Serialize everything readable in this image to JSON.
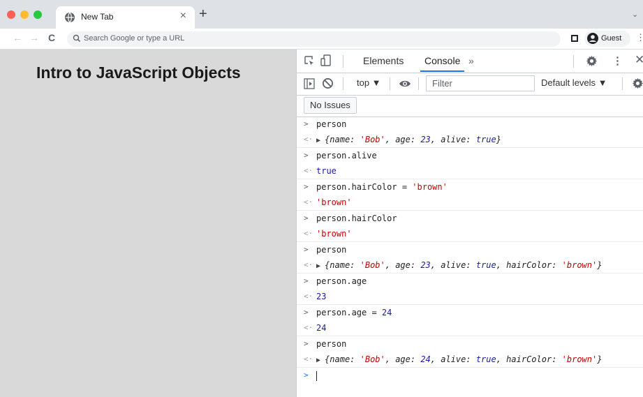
{
  "browser": {
    "tab_title": "New Tab",
    "tab_close": "×",
    "new_tab": "+",
    "tabs_menu": "⌄",
    "omnibox_placeholder": "Search Google or type a URL",
    "profile_label": "Guest"
  },
  "page": {
    "heading": "Intro to JavaScript Objects"
  },
  "devtools": {
    "tabs": {
      "elements": "Elements",
      "console": "Console",
      "more": "»"
    },
    "context": "top ▼",
    "filter_placeholder": "Filter",
    "levels": "Default levels ▼",
    "issues": "No Issues"
  },
  "console": {
    "prompt_symbol": ">",
    "return_symbol": "<·",
    "entries": [
      {
        "input": "person",
        "output": "{name: 'Bob', age: 23, alive: true}"
      },
      {
        "input": "person.alive",
        "output": "true"
      },
      {
        "input": "person.hairColor = 'brown'",
        "output": "'brown'"
      },
      {
        "input": "person.hairColor",
        "output": "'brown'"
      },
      {
        "input": "person",
        "output": "{name: 'Bob', age: 23, alive: true, hairColor: 'brown'}"
      },
      {
        "input": "person.age",
        "output": "23"
      },
      {
        "input": "person.age = 24",
        "output": "24"
      },
      {
        "input": "person",
        "output": "{name: 'Bob', age: 24, alive: true, hairColor: 'brown'}"
      }
    ]
  },
  "colors": {
    "accent": "#1a73e8",
    "string": "#c80000",
    "number": "#1a1aa6",
    "page_bg": "#d9d9d9"
  },
  "icons": [
    "globe-icon",
    "search-icon",
    "back-icon",
    "forward-icon",
    "reload-icon",
    "side-panel-icon",
    "profile-icon",
    "kebab-menu-icon",
    "inspect-icon",
    "device-toolbar-icon",
    "settings-icon",
    "close-icon",
    "sidebar-toggle-icon",
    "clear-console-icon",
    "eye-icon"
  ]
}
